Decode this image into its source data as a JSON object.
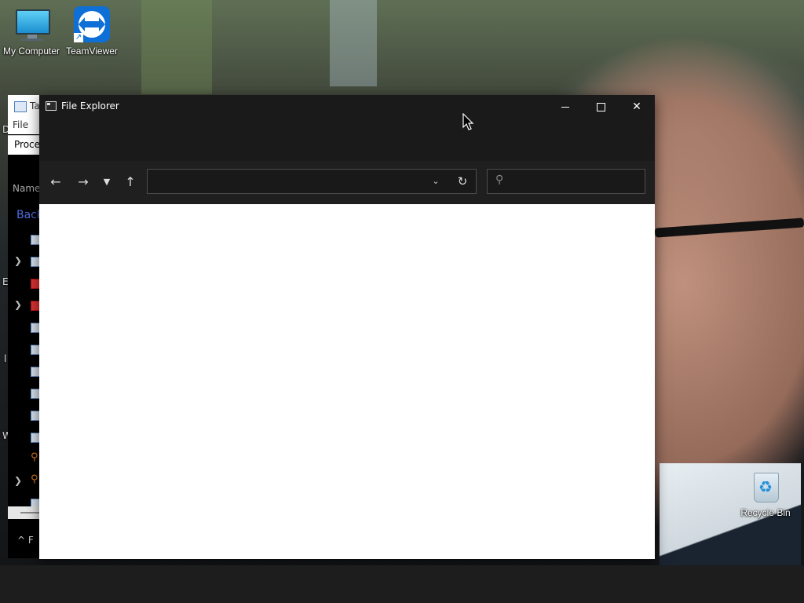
{
  "desktop": {
    "icons": [
      {
        "label": "My Computer",
        "icon": "computer-icon"
      },
      {
        "label": "TeamViewer",
        "icon": "teamviewer-icon"
      },
      {
        "label": "Recycle Bin",
        "icon": "recycle-bin-icon"
      }
    ],
    "side_letters": [
      "D",
      "E",
      "l",
      "W"
    ]
  },
  "task_manager": {
    "title": "Ta",
    "menu_file": "File",
    "tab_processes": "Proces",
    "column_name": "Name",
    "group_background": "Back",
    "footer": "F"
  },
  "explorer": {
    "title": "File Explorer",
    "address": {
      "value": "",
      "placeholder": ""
    },
    "search": {
      "value": "",
      "placeholder": ""
    },
    "colors": {
      "titlebar": "#1a1a1a",
      "navbar": "#1f1f1f",
      "content": "#ffffff"
    }
  }
}
